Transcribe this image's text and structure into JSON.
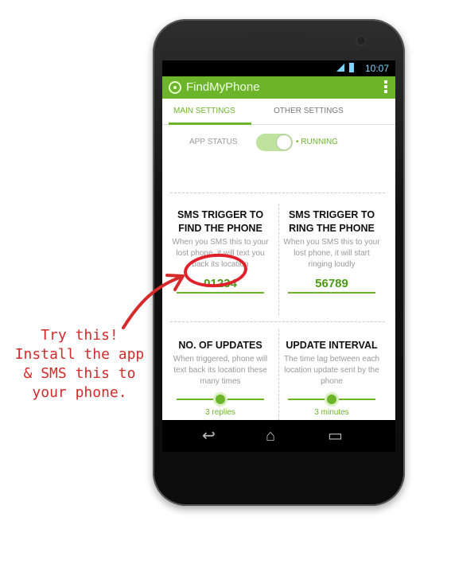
{
  "status_bar": {
    "time": "10:07"
  },
  "app": {
    "title": "FindMyPhone"
  },
  "tabs": [
    {
      "label": "MAIN SETTINGS",
      "active": true
    },
    {
      "label": "OTHER SETTINGS",
      "active": false
    }
  ],
  "app_status": {
    "label": "APP STATUS",
    "state": "RUNNING",
    "enabled": true
  },
  "cards": {
    "sms_find": {
      "heading": "SMS TRIGGER TO FIND THE PHONE",
      "desc": "When you SMS this to your lost phone, it will text you back its location",
      "value": "01234"
    },
    "sms_ring": {
      "heading": "SMS TRIGGER TO RING THE PHONE",
      "desc": "When you SMS this to your lost phone, it will start ringing loudly",
      "value": "56789"
    },
    "updates": {
      "heading": "NO. OF UPDATES",
      "desc": "When triggered, phone will text back its location these many times",
      "caption": "3 replies"
    },
    "interval": {
      "heading": "UPDATE INTERVAL",
      "desc": "The time lag between each location update sent by the phone",
      "caption": "3 minutes"
    }
  },
  "annotation": {
    "line1": "Try this!",
    "line2": "Install the app",
    "line3": "& SMS this to",
    "line4": "your phone.",
    "color": "#d42a2a"
  },
  "colors": {
    "accent": "#6cb52a",
    "annotation": "#e0202a"
  },
  "icons": {
    "logo": "crosshair-icon",
    "menu": "overflow-menu-icon",
    "back": "back-icon",
    "home": "home-icon",
    "recents": "recents-icon"
  }
}
